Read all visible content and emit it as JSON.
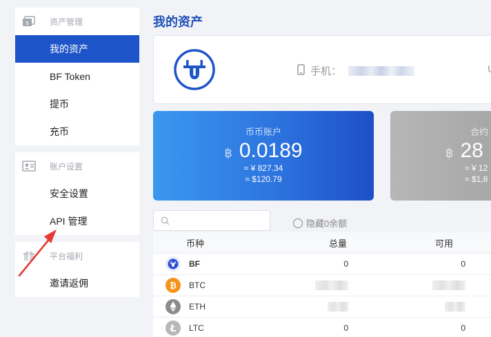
{
  "sidebar": {
    "groups": [
      {
        "title": "资产管理",
        "icon": "wallet-icon",
        "items": [
          {
            "label": "我的资产",
            "active": true
          },
          {
            "label": "BF Token"
          },
          {
            "label": "提币"
          },
          {
            "label": "充币"
          }
        ]
      },
      {
        "title": "账户设置",
        "icon": "id-card-icon",
        "items": [
          {
            "label": "安全设置"
          },
          {
            "label": "API 管理"
          }
        ]
      },
      {
        "title": "平台福利",
        "icon": "gift-icon",
        "items": [
          {
            "label": "邀请返佣"
          }
        ]
      }
    ]
  },
  "page": {
    "title": "我的资产"
  },
  "profile": {
    "phone_label": "手机：",
    "cut_label": "U"
  },
  "cards": {
    "spot": {
      "title": "币币账户",
      "symbol": "฿",
      "balance": "0.0189",
      "cny": "≈ ¥ 827.34",
      "usd": "≈ $120.79"
    },
    "contract": {
      "title": "合约",
      "symbol": "฿",
      "balance": "28",
      "cny": "≈ ¥ 12",
      "usd": "≈ $1,8"
    }
  },
  "search": {
    "placeholder": ""
  },
  "hide_zero": {
    "label": "隐藏0余额"
  },
  "table": {
    "headers": {
      "coin": "币种",
      "total": "总量",
      "available": "可用"
    },
    "rows": [
      {
        "coin": "BF",
        "total": "0",
        "available": "0"
      },
      {
        "coin": "BTC",
        "total": "",
        "available": ""
      },
      {
        "coin": "ETH",
        "total": "",
        "available": ""
      },
      {
        "coin": "LTC",
        "total": "0",
        "available": "0"
      }
    ]
  },
  "colors": {
    "accent": "#1d55c8",
    "title": "#1d4fb8",
    "btc": "#f7931a",
    "eth": "#8c8c8c",
    "ltc": "#b8b8b8",
    "arrow": "#e53935"
  }
}
